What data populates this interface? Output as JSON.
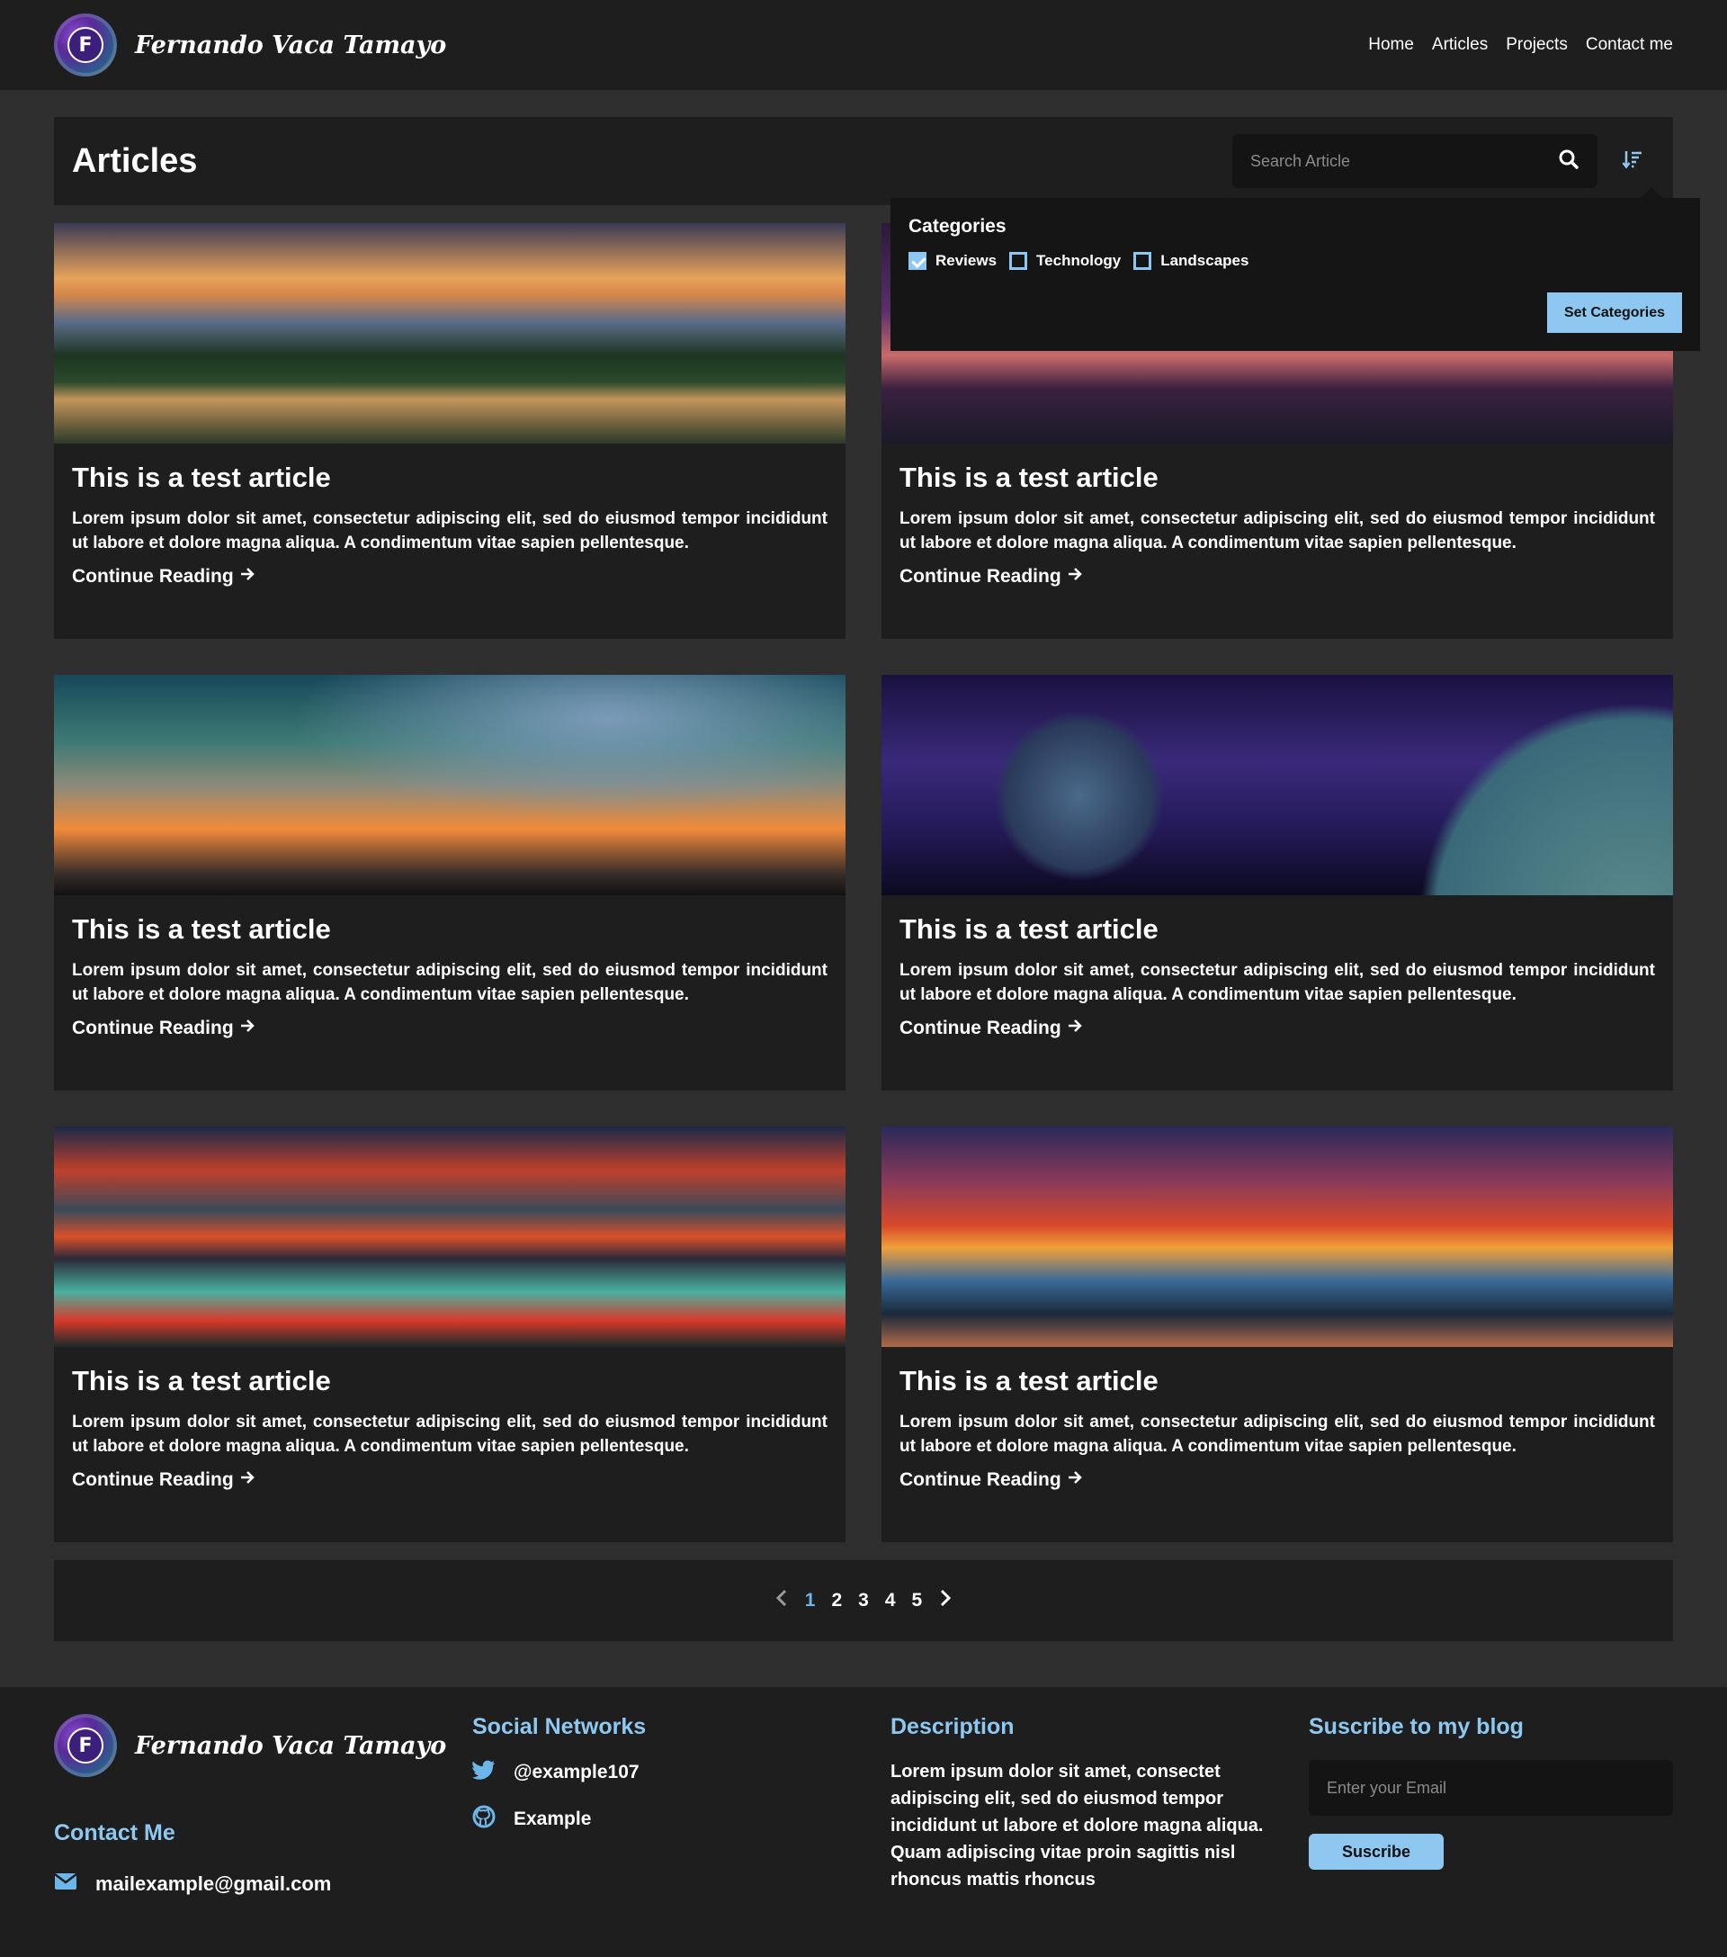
{
  "navbar": {
    "brand_name": "Fernando Vaca Tamayo",
    "logo_letter": "F",
    "links": [
      "Home",
      "Articles",
      "Projects",
      "Contact me"
    ]
  },
  "header": {
    "title": "Articles",
    "search_placeholder": "Search Article"
  },
  "categories": {
    "title": "Categories",
    "items": [
      {
        "label": "Reviews",
        "checked": true
      },
      {
        "label": "Technology",
        "checked": false
      },
      {
        "label": "Landscapes",
        "checked": false
      }
    ],
    "button_label": "Set Categories"
  },
  "articles": [
    {
      "title": "This is a test article",
      "excerpt": "Lorem ipsum dolor sit amet, consectetur adipiscing elit, sed do eiusmod tempor incididunt ut labore et dolore magna aliqua. A condimentum vitae sapien pellentesque.",
      "link": "Continue Reading"
    },
    {
      "title": "This is a test article",
      "excerpt": "Lorem ipsum dolor sit amet, consectetur adipiscing elit, sed do eiusmod tempor incididunt ut labore et dolore magna aliqua. A condimentum vitae sapien pellentesque.",
      "link": "Continue Reading"
    },
    {
      "title": "This is a test article",
      "excerpt": "Lorem ipsum dolor sit amet, consectetur adipiscing elit, sed do eiusmod tempor incididunt ut labore et dolore magna aliqua. A condimentum vitae sapien pellentesque.",
      "link": "Continue Reading"
    },
    {
      "title": "This is a test article",
      "excerpt": "Lorem ipsum dolor sit amet, consectetur adipiscing elit, sed do eiusmod tempor incididunt ut labore et dolore magna aliqua. A condimentum vitae sapien pellentesque.",
      "link": "Continue Reading"
    },
    {
      "title": "This is a test article",
      "excerpt": "Lorem ipsum dolor sit amet, consectetur adipiscing elit, sed do eiusmod tempor incididunt ut labore et dolore magna aliqua. A condimentum vitae sapien pellentesque.",
      "link": "Continue Reading"
    },
    {
      "title": "This is a test article",
      "excerpt": "Lorem ipsum dolor sit amet, consectetur adipiscing elit, sed do eiusmod tempor incididunt ut labore et dolore magna aliqua. A condimentum vitae sapien pellentesque.",
      "link": "Continue Reading"
    }
  ],
  "pagination": {
    "pages": [
      "1",
      "2",
      "3",
      "4",
      "5"
    ],
    "active": "1"
  },
  "footer": {
    "brand_name": "Fernando Vaca Tamayo",
    "contact_title": "Contact Me",
    "email": "mailexample@gmail.com",
    "social_title": "Social Networks",
    "twitter": "@example107",
    "github": "Example",
    "description_title": "Description",
    "description": "Lorem ipsum dolor sit amet, consectet adipiscing elit, sed do eiusmod tempor incididunt ut labore et dolore magna aliqua. Quam adipiscing vitae proin sagittis nisl rhoncus mattis rhoncus",
    "subscribe_title": "Suscribe to my blog",
    "subscribe_placeholder": "Enter your Email",
    "subscribe_button": "Suscribe"
  },
  "colors": {
    "accent": "#8ec8f0",
    "active_page": "#6cb6ea",
    "panel": "#1e1e1e",
    "page_bg": "#2f2f2f"
  },
  "icons": [
    "search-icon",
    "sort-icon",
    "arrow-right-icon",
    "chevron-left-icon",
    "chevron-right-icon",
    "twitter-icon",
    "github-icon",
    "mail-icon"
  ]
}
